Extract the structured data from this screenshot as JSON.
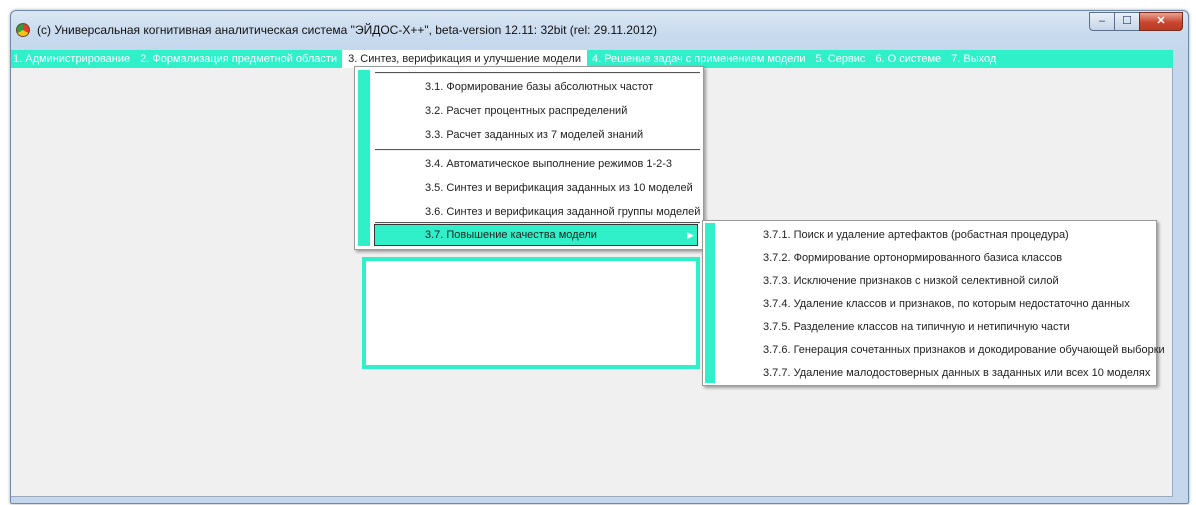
{
  "window": {
    "title": "(с) Универсальная когнитивная аналитическая система \"ЭЙДОС-X++\", beta-version 12.11: 32bit (rel: 29.11.2012)",
    "controls": {
      "minimize": "–",
      "maximize": "☐",
      "close": "✕"
    }
  },
  "menubar": {
    "items": [
      "1. Администрирование",
      "2. Формализация предметной области",
      "3. Синтез, верификация и улучшение модели",
      "4. Решение задач с применением модели",
      "5. Сервис",
      "6. О системе",
      "7. Выход"
    ],
    "active_index": 2
  },
  "submenu_3": {
    "items": [
      "3.1. Формирование базы абсолютных частот",
      "3.2. Расчет процентных распределений",
      "3.3. Расчет заданных из 7 моделей знаний",
      "3.4. Автоматическое выполнение режимов 1-2-3",
      "3.5. Синтез и верификация заданных из 10 моделей",
      "3.6. Синтез и верификация заданной группы моделей",
      "3.7. Повышение качества модели"
    ],
    "highlighted_index": 6
  },
  "submenu_3_7": {
    "items": [
      "3.7.1. Поиск и удаление артефактов (робастная процедура)",
      "3.7.2. Формирование ортонормированного базиса классов",
      "3.7.3. Исключение признаков с низкой селективной силой",
      "3.7.4. Удаление классов и признаков, по которым недостаточно данных",
      "3.7.5. Разделение классов на типичную и нетипичную части",
      "3.7.6. Генерация сочетанных признаков и докодирование обучающей выборки",
      "3.7.7. Удаление малодостоверных данных в заданных или всех 10 моделях"
    ]
  },
  "colors": {
    "accent": "#2ff0c9",
    "window_frame": "#c4d7ec",
    "client_bg": "#f0f0f0"
  }
}
